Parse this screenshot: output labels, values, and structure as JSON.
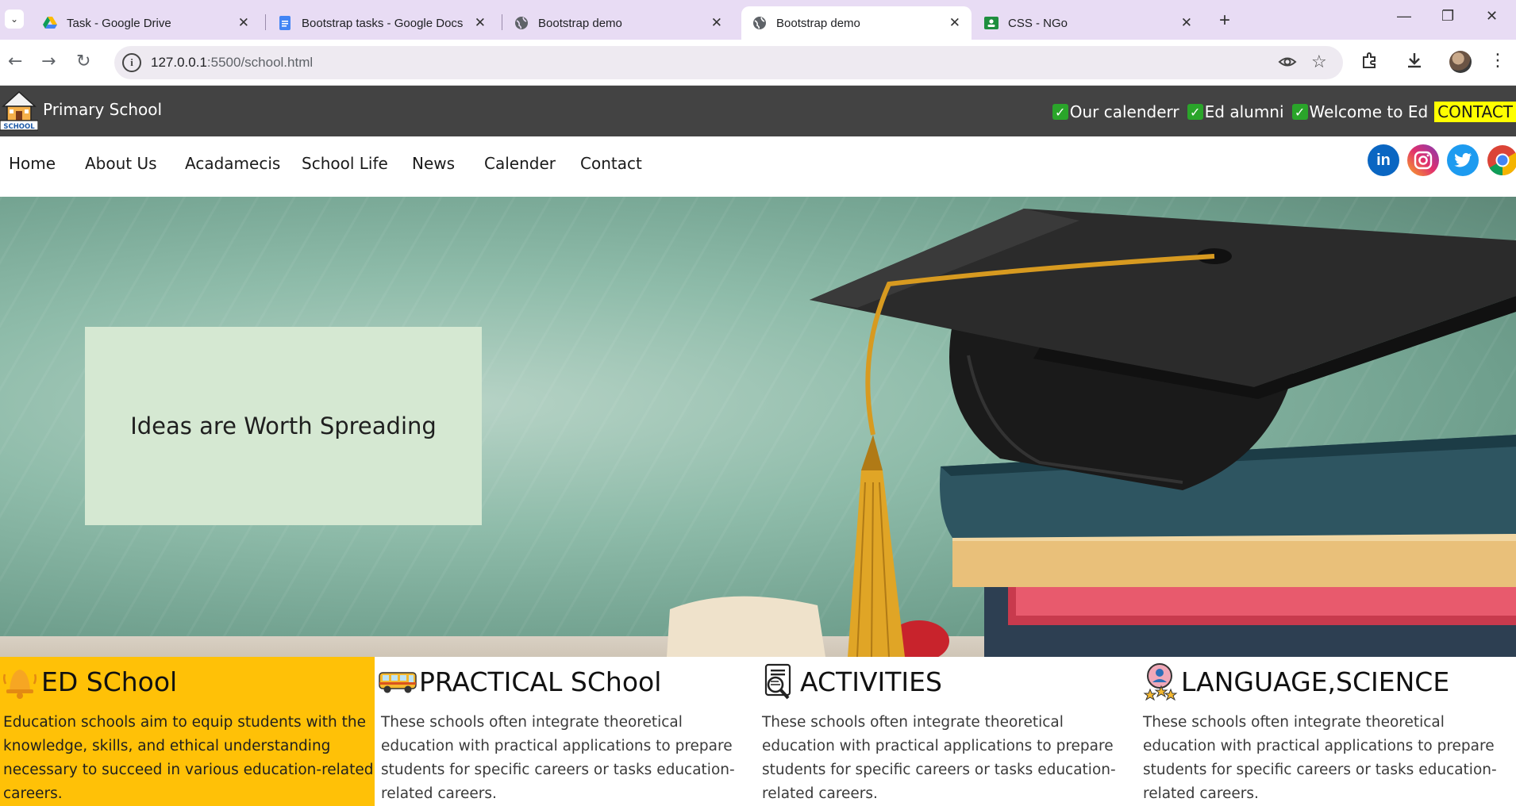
{
  "browser": {
    "tabs": [
      {
        "title": "Task - Google Drive",
        "favicon": "google-drive-icon",
        "active": false
      },
      {
        "title": "Bootstrap tasks - Google Docs",
        "favicon": "google-docs-icon",
        "active": false
      },
      {
        "title": "Bootstrap demo",
        "favicon": "globe-icon",
        "active": false
      },
      {
        "title": "Bootstrap demo",
        "favicon": "globe-icon",
        "active": true
      },
      {
        "title": "CSS - NGo",
        "favicon": "google-classroom-icon",
        "active": false
      }
    ],
    "url_host": "127.0.0.1",
    "url_rest": ":5500/school.html"
  },
  "site": {
    "brand": "Primary School",
    "logo_text": "SCHOOL",
    "top_links": [
      "Our calenderr",
      "Ed alumni",
      "Welcome to Ed"
    ],
    "contact_cta": "CONTACT",
    "nav": [
      "Home",
      "About Us",
      "Acadamecis",
      "School Life",
      "News",
      "Calender",
      "Contact"
    ],
    "social": [
      "linkedin-icon",
      "instagram-icon",
      "twitter-icon",
      "chrome-icon"
    ],
    "social_label_linkedin": "in"
  },
  "hero": {
    "tagline": "Ideas are Worth Spreading"
  },
  "features": [
    {
      "icon": "bell-icon",
      "title": "ED SChool",
      "text": "Education schools aim to equip students with the knowledge, skills, and ethical understanding necessary to succeed in various education-related careers."
    },
    {
      "icon": "school-bus-icon",
      "title": "PRACTICAL SChool",
      "text": "These schools often integrate theoretical education with practical applications to prepare students for specific careers or tasks education-related careers."
    },
    {
      "icon": "search-document-icon",
      "title": "ACTIVITIES",
      "text": "These schools often integrate theoretical education with practical applications to prepare students for specific careers or tasks education-related careers."
    },
    {
      "icon": "award-badge-icon",
      "title": "LANGUAGE,SCIENCE",
      "text": "These schools often integrate theoretical education with practical applications to prepare students for specific careers or tasks education-related careers."
    }
  ],
  "colors": {
    "topbar": "#434343",
    "contact_highlight": "#ffff00",
    "feature_highlight": "#ffc107",
    "tagline_box": "#d5e8d2"
  }
}
